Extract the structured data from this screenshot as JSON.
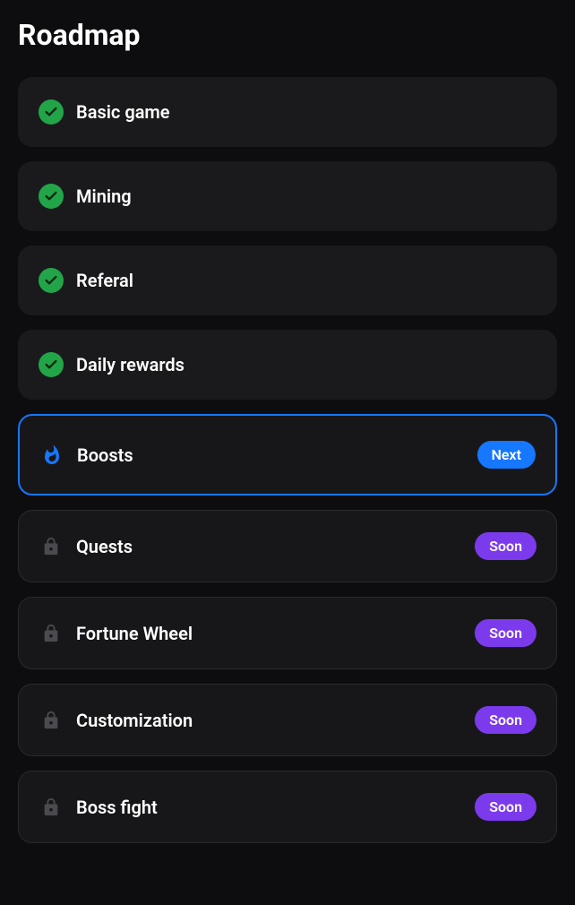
{
  "title": "Roadmap",
  "badges": {
    "next": "Next",
    "soon": "Soon"
  },
  "items": [
    {
      "label": "Basic game",
      "status": "done"
    },
    {
      "label": "Mining",
      "status": "done"
    },
    {
      "label": "Referal",
      "status": "done"
    },
    {
      "label": "Daily rewards",
      "status": "done"
    },
    {
      "label": "Boosts",
      "status": "next"
    },
    {
      "label": "Quests",
      "status": "locked"
    },
    {
      "label": "Fortune Wheel",
      "status": "locked"
    },
    {
      "label": "Customization",
      "status": "locked"
    },
    {
      "label": "Boss fight",
      "status": "locked"
    }
  ]
}
